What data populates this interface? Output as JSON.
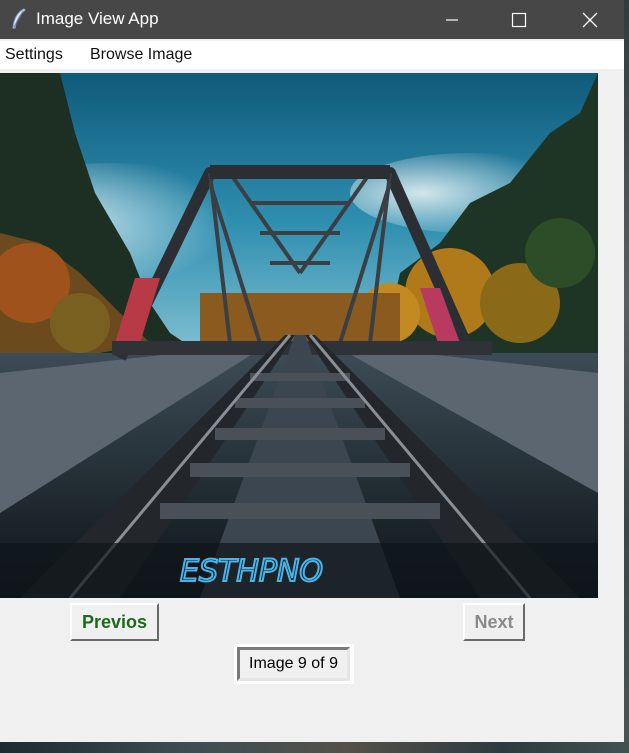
{
  "window": {
    "title": "Image View App",
    "icon": "feather-icon",
    "controls": [
      "minimize-icon",
      "maximize-icon",
      "close-icon"
    ]
  },
  "menu": {
    "settings_label": "Settings",
    "browse_label": "Browse Image"
  },
  "viewer": {
    "image_subject": "railway bridge with tracks",
    "graffiti_text": "ESTHPNO"
  },
  "nav": {
    "prev_label": "Previos",
    "next_label": "Next",
    "next_enabled": false
  },
  "status": {
    "text": "Image 9 of 9"
  },
  "colors": {
    "titlebar": "#474747",
    "prev_text": "#1c6b1c",
    "next_text_disabled": "#8a8a8a",
    "window_bg": "#f0f0f0"
  }
}
